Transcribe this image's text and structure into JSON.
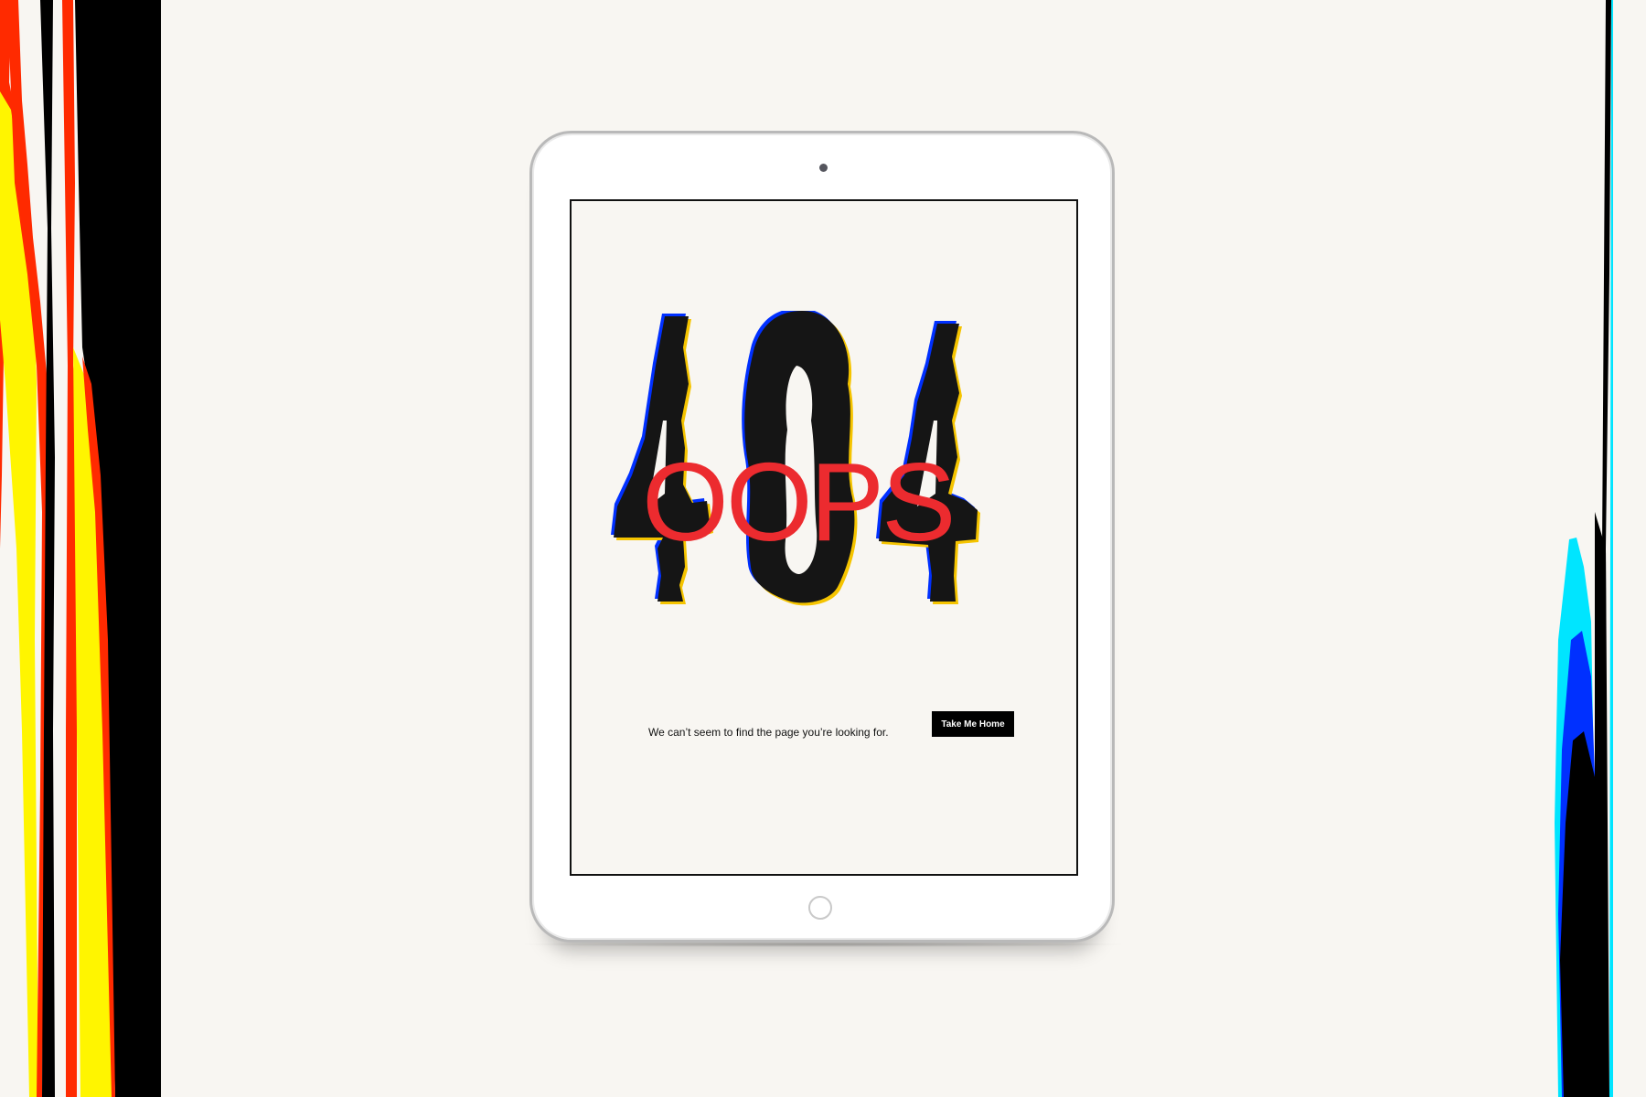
{
  "screen": {
    "oops_text": "OOPS",
    "error_code": "404",
    "message": "We can’t seem to find the page you’re looking for.",
    "cta_label": "Take Me Home"
  },
  "colors": {
    "background": "#f8f6f2",
    "oops_red": "#ec2b2f",
    "glyph_black": "#151515",
    "button_black": "#000000",
    "glitch_yellow": "#fff500",
    "glitch_red": "#ff2a00",
    "glitch_cyan": "#00e5ff",
    "glitch_blue": "#0030ff"
  }
}
